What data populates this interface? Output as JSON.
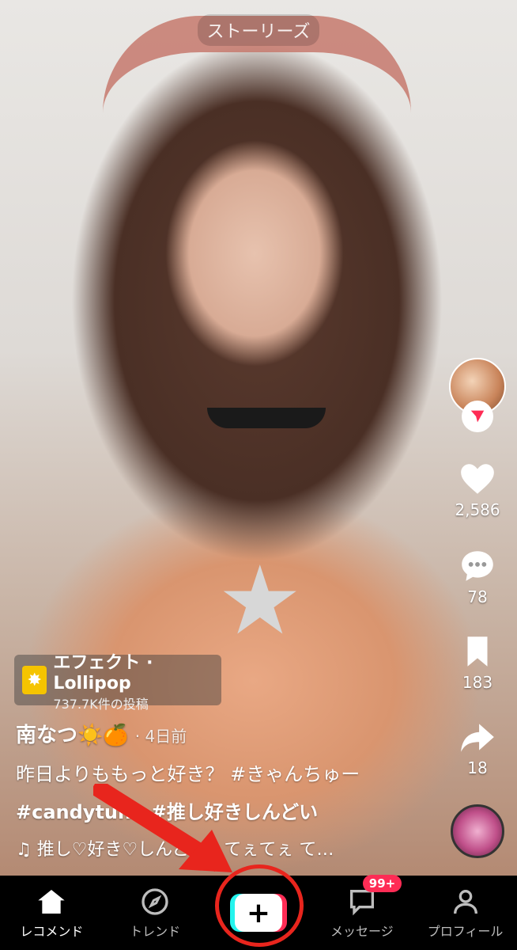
{
  "top": {
    "stories_label": "ストーリーズ"
  },
  "rail": {
    "like_count": "2,586",
    "comment_count": "78",
    "bookmark_count": "183",
    "share_count": "18"
  },
  "effect": {
    "title": "エフェクト · Lollipop",
    "posts": "737.7K件の投稿"
  },
  "post": {
    "author": "南なつ☀️🍊",
    "time_ago": "· 4日前",
    "caption_line1": "昨日よりももっと好き？ #きゃんちゅー",
    "caption_line2": "#candytune #推し好きしんどい",
    "music": "♫ 推し♡好き♡しんどい - てぇてぇ て…"
  },
  "nav": {
    "home": "レコメンド",
    "trend": "トレンド",
    "create": "+",
    "messages": "メッセージ",
    "messages_badge": "99+",
    "profile": "プロフィール"
  },
  "colors": {
    "annotation_red": "#e8251d",
    "tiktok_cyan": "#25f4ee",
    "tiktok_pink": "#fe2c55"
  }
}
